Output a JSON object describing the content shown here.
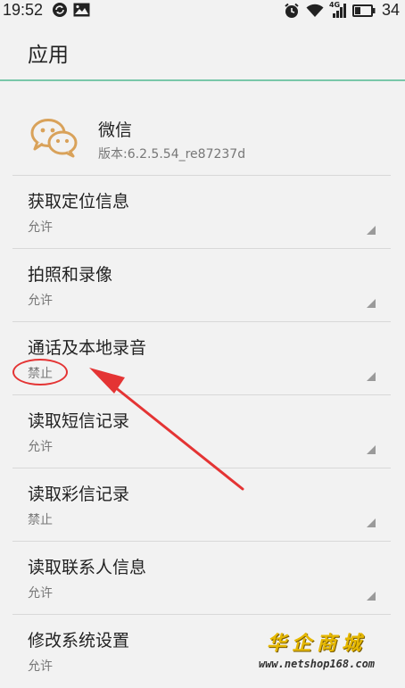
{
  "status_bar": {
    "time": "19:52",
    "battery_level": "34",
    "network_label": "4G"
  },
  "header": {
    "title": "应用"
  },
  "app": {
    "name": "微信",
    "version": "版本:6.2.5.54_re87237d"
  },
  "permissions": [
    {
      "title": "获取定位信息",
      "value": "允许"
    },
    {
      "title": "拍照和录像",
      "value": "允许"
    },
    {
      "title": "通话及本地录音",
      "value": "禁止"
    },
    {
      "title": "读取短信记录",
      "value": "允许"
    },
    {
      "title": "读取彩信记录",
      "value": "禁止"
    },
    {
      "title": "读取联系人信息",
      "value": "允许"
    },
    {
      "title": "修改系统设置",
      "value": "允许"
    }
  ],
  "watermark": {
    "title": "华企商城",
    "url": "www.netshop168.com"
  },
  "colors": {
    "accent_line": "#79c7a9",
    "annotation_red": "#e43434",
    "watermark_gold": "#e6b800"
  }
}
